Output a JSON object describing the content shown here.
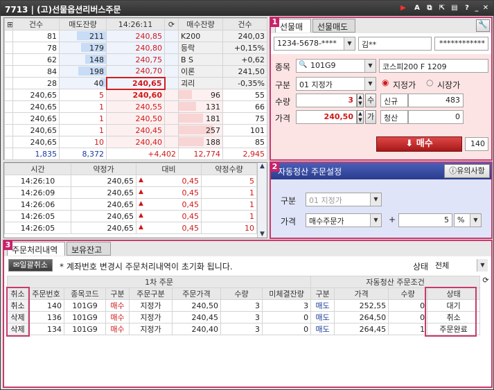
{
  "window": {
    "title": "7713 | (고)선물옵션리버스주문"
  },
  "quote": {
    "headers": {
      "count_l": "건수",
      "sell_rem": "매도잔량",
      "time": "14:26:11",
      "buy_rem": "매수잔량",
      "count_r": "건수"
    },
    "sell_rows": [
      {
        "cnt": "81",
        "qty": "211",
        "price": "240,85",
        "label": "K200",
        "value": "240,03",
        "bar": 211
      },
      {
        "cnt": "78",
        "qty": "179",
        "price": "240,80",
        "label": "등락",
        "value": "+0,15%",
        "bar": 179
      },
      {
        "cnt": "62",
        "qty": "148",
        "price": "240,75",
        "label": "B S",
        "value": "+0,62",
        "bar": 148
      },
      {
        "cnt": "84",
        "qty": "198",
        "price": "240,70",
        "label": "이론",
        "value": "241,50",
        "bar": 198
      },
      {
        "cnt": "28",
        "qty": "40",
        "price": "240,65",
        "label": "괴리",
        "value": "-0,35%",
        "bar": 40
      }
    ],
    "buy_rows": [
      {
        "exec": "240,65",
        "qty": "5",
        "price": "240,60",
        "bq": "96",
        "bc": "55",
        "bar": 96
      },
      {
        "exec": "240,65",
        "qty": "1",
        "price": "240,55",
        "bq": "131",
        "bc": "66",
        "bar": 131
      },
      {
        "exec": "240,65",
        "qty": "1",
        "price": "240,50",
        "bq": "181",
        "bc": "75",
        "bar": 181
      },
      {
        "exec": "240,65",
        "qty": "1",
        "price": "240,45",
        "bq": "257",
        "bc": "101",
        "bar": 257
      },
      {
        "exec": "240,65",
        "qty": "10",
        "price": "240,40",
        "bq": "188",
        "bc": "85",
        "bar": 188
      }
    ],
    "totals": {
      "cnt_l": "1,835",
      "sell": "8,372",
      "diff": "+4,402",
      "buy": "12,774",
      "cnt_r": "2,945"
    }
  },
  "trades": {
    "headers": [
      "시간",
      "약정가",
      "대비",
      "약정수량"
    ],
    "rows": [
      {
        "time": "14:26:10",
        "price": "240,65",
        "diff": "0,45",
        "qty": "5"
      },
      {
        "time": "14:26:09",
        "price": "240,65",
        "diff": "0,45",
        "qty": "1"
      },
      {
        "time": "14:26:06",
        "price": "240,65",
        "diff": "0,45",
        "qty": "1"
      },
      {
        "time": "14:26:05",
        "price": "240,65",
        "diff": "0,45",
        "qty": "1"
      },
      {
        "time": "14:26:05",
        "price": "240,65",
        "diff": "0,45",
        "qty": "10"
      }
    ]
  },
  "order": {
    "badge": "1",
    "tab_buy": "선물매수",
    "tab_sell": "선물매도",
    "account": "1234-5678-****",
    "account_name": "김**",
    "password": "************",
    "code_label": "종목",
    "code": "101G9",
    "code_name": "코스피200 F 1209",
    "type_label": "구분",
    "type": "01 지정가",
    "radio_limit": "지정가",
    "radio_market": "시장가",
    "qty_label": "수량",
    "qty": "3",
    "qty_btn": "수",
    "price_label": "가격",
    "price": "240,50",
    "price_btn": "가",
    "new_label": "신규",
    "new_val": "483",
    "clear_label": "청산",
    "clear_val": "0",
    "submit": "매수",
    "submit_qty": "140"
  },
  "auto": {
    "badge": "2",
    "title": "자동청산 주문설정",
    "notice_btn": "유의사항",
    "type_label": "구분",
    "type": "01 지정가",
    "price_label": "가격",
    "price_type": "매수주문가",
    "plus": "+",
    "offset": "5",
    "unit": "%"
  },
  "history": {
    "badge": "3",
    "tab1": "주문처리내역",
    "tab2": "보유잔고",
    "cancel_all": "일괄취소",
    "notice": "* 계좌번호 변경시 주문처리내역이 초기화 됩니다.",
    "status_label": "상태",
    "status_value": "전체",
    "group1": "1차 주문",
    "group2": "자동청산 주문조건",
    "cols": [
      "취소",
      "주문번호",
      "종목코드",
      "구분",
      "주문구분",
      "주문가격",
      "수량",
      "미체결잔량",
      "구분",
      "가격",
      "수량",
      "상태"
    ],
    "rows": [
      {
        "act": "취소",
        "no": "140",
        "code": "101G9",
        "side": "매수",
        "otype": "지정가",
        "price": "240,50",
        "qty": "3",
        "unfilled": "3",
        "aside": "매도",
        "aprice": "252,55",
        "aqty": "0",
        "status": "대기"
      },
      {
        "act": "삭제",
        "no": "136",
        "code": "101G9",
        "side": "매수",
        "otype": "지정가",
        "price": "240,45",
        "qty": "3",
        "unfilled": "0",
        "aside": "매도",
        "aprice": "264,50",
        "aqty": "0",
        "status": "취소"
      },
      {
        "act": "삭제",
        "no": "134",
        "code": "101G9",
        "side": "매수",
        "otype": "지정가",
        "price": "240,40",
        "qty": "3",
        "unfilled": "0",
        "aside": "매도",
        "aprice": "264,45",
        "aqty": "1",
        "status": "주문완료"
      }
    ]
  }
}
